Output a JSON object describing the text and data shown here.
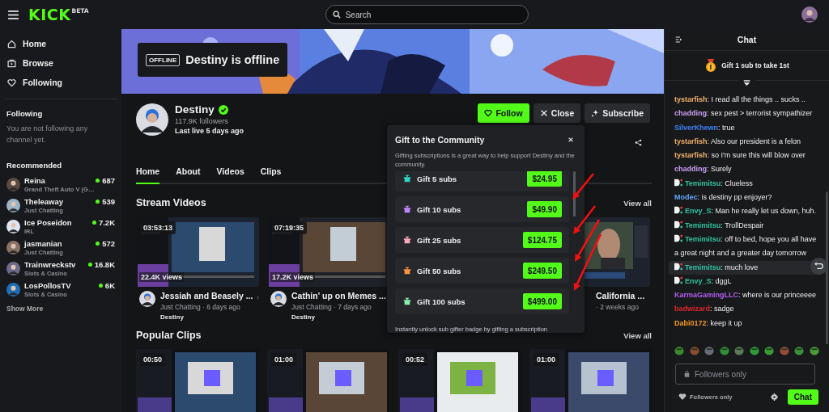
{
  "header": {
    "logo": "KICK",
    "logo_badge": "BETA",
    "search": {
      "placeholder": "Search"
    }
  },
  "sidebar": {
    "nav": [
      {
        "label": "Home",
        "kind": "home"
      },
      {
        "label": "Browse",
        "kind": "browse"
      },
      {
        "label": "Following",
        "kind": "following"
      }
    ],
    "following_heading": "Following",
    "following_empty": "You are not following any channel yet.",
    "recommended_heading": "Recommended",
    "recommended": [
      {
        "name": "Reina",
        "category": "Grand Theft Auto V (G…",
        "viewers": "687"
      },
      {
        "name": "Theleaway",
        "category": "Just Chatting",
        "viewers": "539"
      },
      {
        "name": "Ice Poseidon",
        "category": "IRL",
        "viewers": "7.2K"
      },
      {
        "name": "jasmanian",
        "category": "Just Chatting",
        "viewers": "572"
      },
      {
        "name": "Trainwreckstv",
        "category": "Slots & Casino",
        "viewers": "16.8K"
      },
      {
        "name": "LosPollosTV",
        "category": "Slots & Casino",
        "viewers": "6K"
      }
    ],
    "show_more": "Show More"
  },
  "banner": {
    "badge": "OFFLINE",
    "text": "Destiny is offline"
  },
  "channel": {
    "name": "Destiny",
    "verified": true,
    "followers": "117.9K followers",
    "last_live": "Last live 5 days ago",
    "buttons": [
      {
        "label": "Follow",
        "kind": "follow"
      },
      {
        "label": "Close",
        "kind": "close"
      },
      {
        "label": "Subscribe",
        "kind": "subscribe"
      }
    ]
  },
  "tabs": [
    {
      "label": "Home",
      "selected": true
    },
    {
      "label": "About",
      "selected": false
    },
    {
      "label": "Videos",
      "selected": false
    },
    {
      "label": "Clips",
      "selected": false
    }
  ],
  "stream_videos": {
    "title": "Stream Videos",
    "view_all": "View all",
    "videos": [
      {
        "kind": "full",
        "duration": "03:53:13",
        "views": "22.4K views",
        "title": "Jessiah and Beasely ...",
        "meta": "Just Chatting · 6 days ago",
        "channel": "Destiny"
      },
      {
        "kind": "full",
        "duration": "07:19:35",
        "views": "17.2K views",
        "title": "Cathin' up on Memes ...",
        "meta": "Just Chatting · 7 days ago",
        "channel": "Destiny"
      },
      {
        "kind": "partial",
        "title": "California ...",
        "meta": "· 2 weeks ago"
      }
    ]
  },
  "popular_clips": {
    "title": "Popular Clips",
    "view_all": "View all",
    "clips": [
      {
        "duration": "00:50"
      },
      {
        "duration": "01:00"
      },
      {
        "duration": "00:52"
      },
      {
        "duration": "01:00"
      }
    ]
  },
  "gift_popup": {
    "title": "Gift to the Community",
    "description": "Gifting subscriptions is a great way to help support Destiny and the community.",
    "options": [
      {
        "label": "Gift 5 subs",
        "price": "$24.95",
        "color": "#2dd4bf"
      },
      {
        "label": "Gift 10 subs",
        "price": "$49.90",
        "color": "#c084fc"
      },
      {
        "label": "Gift 25 subs",
        "price": "$124.75",
        "color": "#f9a8b4"
      },
      {
        "label": "Gift 50 subs",
        "price": "$249.50",
        "color": "#fb923c"
      },
      {
        "label": "Gift 100 subs",
        "price": "$499.00",
        "color": "#86efac"
      }
    ],
    "footer": "Instantly unlock sub gifter badge by gifting a subscription"
  },
  "chat": {
    "title": "Chat",
    "pinned": "Gift 1 sub to take 1st",
    "messages": [
      {
        "user": "tystarfish",
        "color": "#f2b36b",
        "text": ": I read all the things .. sucks ..",
        "badge": false,
        "highlighted": false
      },
      {
        "user": "chadding",
        "color": "#c9a0f5",
        "text": ": sex pest > terrorist sympathizer",
        "badge": false,
        "highlighted": false
      },
      {
        "user": "SilverKhewn",
        "color": "#3b82f6",
        "text": ": true",
        "badge": false,
        "highlighted": false
      },
      {
        "user": "tystarfish",
        "color": "#f2b36b",
        "text": ": Also our president is a felon",
        "badge": false,
        "highlighted": false
      },
      {
        "user": "tystarfish",
        "color": "#f2b36b",
        "text": ": so I'm sure this will blow over",
        "badge": false,
        "highlighted": false
      },
      {
        "user": "chadding",
        "color": "#c9a0f5",
        "text": ": Surely",
        "badge": false,
        "highlighted": false
      },
      {
        "user": "Temimitsu",
        "color": "#2ec4a0",
        "text": ": Clueless",
        "badge": true,
        "highlighted": false
      },
      {
        "user": "Modec",
        "color": "#60a5fa",
        "text": ": is destiny pp enjoyer?",
        "badge": false,
        "highlighted": false
      },
      {
        "user": "Envy_S",
        "color": "#2ec4a0",
        "text": ": Man he really let us down, huh.",
        "badge": true,
        "highlighted": false
      },
      {
        "user": "Temimitsu",
        "color": "#2ec4a0",
        "text": ": TrollDespair",
        "badge": true,
        "highlighted": false
      },
      {
        "user": "Temimitsu",
        "color": "#2ec4a0",
        "text": ": off to bed, hope you all have a great night and a greater day tomorrow",
        "badge": true,
        "highlighted": false
      },
      {
        "user": "Temimitsu",
        "color": "#2ec4a0",
        "text": ": much love",
        "badge": true,
        "highlighted": true
      },
      {
        "user": "Envy_S",
        "color": "#2ec4a0",
        "text": ": dggL",
        "badge": true,
        "highlighted": false
      },
      {
        "user": "KarmaGamingLLC",
        "color": "#b45cf0",
        "text": ": where is our princeeee",
        "badge": false,
        "highlighted": false
      },
      {
        "user": "badwizard",
        "color": "#e0242a",
        "text": ": sadge",
        "badge": false,
        "highlighted": false
      },
      {
        "user": "Dabi0172",
        "color": "#f59a23",
        "text": ": keep it up",
        "badge": false,
        "highlighted": false
      }
    ],
    "input": {
      "placeholder": "Followers only"
    },
    "mode": "Followers only",
    "send": "Chat"
  }
}
